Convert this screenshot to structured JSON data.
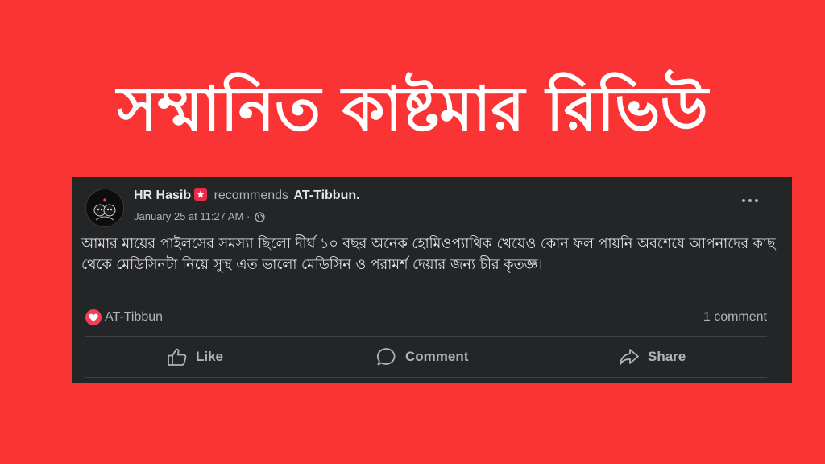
{
  "headline": "সম্মানিত কাষ্টমার রিভিউ",
  "post": {
    "author_name": "HR Hasib",
    "verb": "recommends",
    "page_name": "AT-Tibbun.",
    "timestamp": "January 25 at 11:27 AM",
    "separator": "·",
    "body": "আমার মায়ের পাইলসের সমস্যা ছিলো দীর্ঘ ১০ বছর অনেক হোমিওপ্যাথিক খেয়েও কোন ফল পায়নি অবশেষে আপনাদের কাছ থেকে মেডিসিনটা নিয়ে সুস্থ এত ভালো মেডিসিন ও পরামর্শ দেয়ার জন্য চীর কৃতজ্ঞ।",
    "reaction_name": "AT-Tibbun",
    "comment_count": "1 comment",
    "actions": {
      "like": "Like",
      "comment": "Comment",
      "share": "Share"
    }
  },
  "colors": {
    "background": "#fa3334",
    "card": "#242526",
    "text": "#e4e6eb",
    "muted": "#b0b3b8",
    "love": "#f33e58"
  },
  "icons": [
    "avatar",
    "verified-badge-icon",
    "globe-icon",
    "more-options-icon",
    "love-reaction-icon",
    "like-icon",
    "comment-icon",
    "share-icon"
  ]
}
